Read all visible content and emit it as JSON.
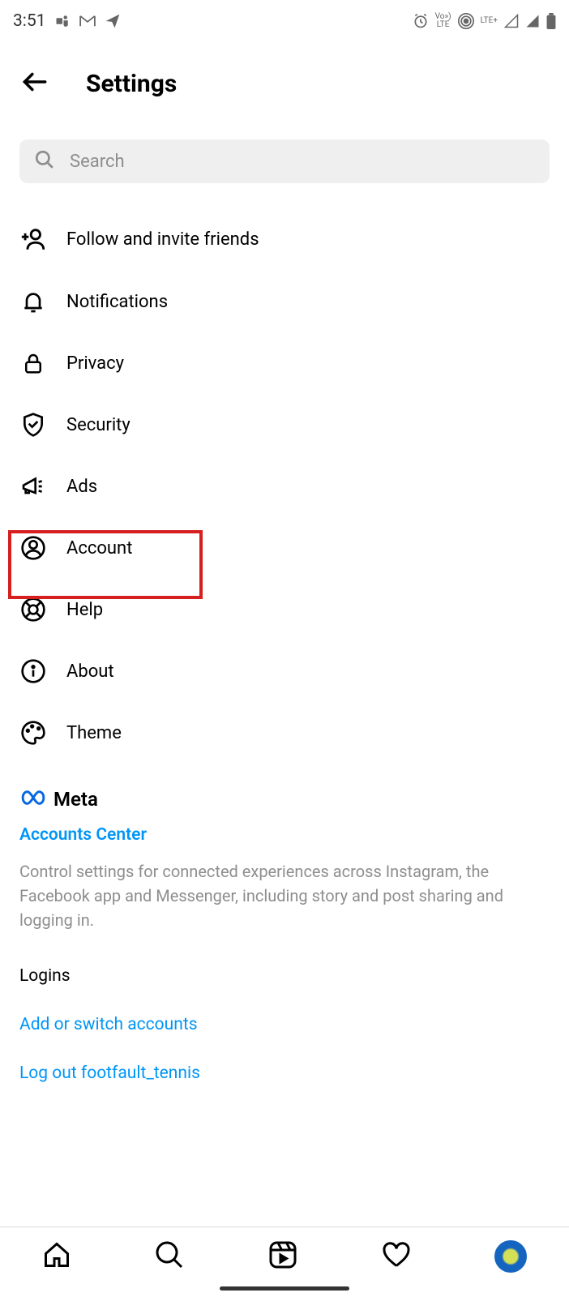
{
  "status": {
    "time": "3:51",
    "lte": "LTE+",
    "volte_top": "Vo»)",
    "volte_bottom": "LTE"
  },
  "header": {
    "title": "Settings"
  },
  "search": {
    "placeholder": "Search"
  },
  "menu": {
    "items": [
      {
        "label": "Follow and invite friends"
      },
      {
        "label": "Notifications"
      },
      {
        "label": "Privacy"
      },
      {
        "label": "Security"
      },
      {
        "label": "Ads"
      },
      {
        "label": "Account"
      },
      {
        "label": "Help"
      },
      {
        "label": "About"
      },
      {
        "label": "Theme"
      }
    ]
  },
  "meta": {
    "brand": "Meta",
    "accounts_center": "Accounts Center",
    "description": "Control settings for connected experiences across Instagram, the Facebook app and Messenger, including story and post sharing and logging in."
  },
  "logins": {
    "title": "Logins",
    "add_switch": "Add or switch accounts",
    "logout": "Log out footfault_tennis"
  }
}
